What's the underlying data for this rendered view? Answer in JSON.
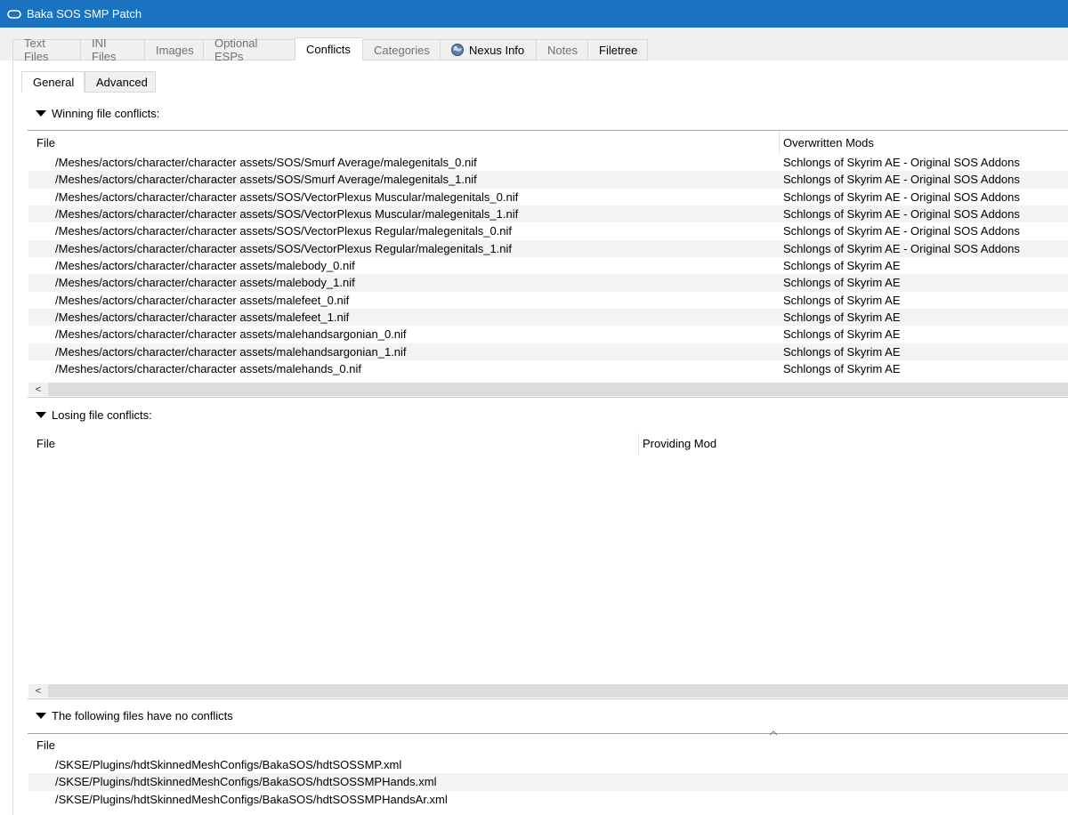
{
  "window": {
    "title": "Baka SOS SMP Patch"
  },
  "tabs": [
    {
      "label": "Text Files"
    },
    {
      "label": "INI Files"
    },
    {
      "label": "Images"
    },
    {
      "label": "Optional ESPs"
    },
    {
      "label": "Conflicts"
    },
    {
      "label": "Categories"
    },
    {
      "label": "Nexus Info"
    },
    {
      "label": "Notes"
    },
    {
      "label": "Filetree"
    }
  ],
  "subtabs": [
    {
      "label": "General"
    },
    {
      "label": "Advanced"
    }
  ],
  "winning": {
    "header": "Winning file conflicts:",
    "col_file": "File",
    "col_mods": "Overwritten Mods",
    "rows": [
      {
        "file": "/Meshes/actors/character/character assets/SOS/Smurf Average/malegenitals_0.nif",
        "mod": "Schlongs of Skyrim AE - Original SOS Addons"
      },
      {
        "file": "/Meshes/actors/character/character assets/SOS/Smurf Average/malegenitals_1.nif",
        "mod": "Schlongs of Skyrim AE - Original SOS Addons"
      },
      {
        "file": "/Meshes/actors/character/character assets/SOS/VectorPlexus Muscular/malegenitals_0.nif",
        "mod": "Schlongs of Skyrim AE - Original SOS Addons"
      },
      {
        "file": "/Meshes/actors/character/character assets/SOS/VectorPlexus Muscular/malegenitals_1.nif",
        "mod": "Schlongs of Skyrim AE - Original SOS Addons"
      },
      {
        "file": "/Meshes/actors/character/character assets/SOS/VectorPlexus Regular/malegenitals_0.nif",
        "mod": "Schlongs of Skyrim AE - Original SOS Addons"
      },
      {
        "file": "/Meshes/actors/character/character assets/SOS/VectorPlexus Regular/malegenitals_1.nif",
        "mod": "Schlongs of Skyrim AE - Original SOS Addons"
      },
      {
        "file": "/Meshes/actors/character/character assets/malebody_0.nif",
        "mod": "Schlongs of Skyrim AE"
      },
      {
        "file": "/Meshes/actors/character/character assets/malebody_1.nif",
        "mod": "Schlongs of Skyrim AE"
      },
      {
        "file": "/Meshes/actors/character/character assets/malefeet_0.nif",
        "mod": "Schlongs of Skyrim AE"
      },
      {
        "file": "/Meshes/actors/character/character assets/malefeet_1.nif",
        "mod": "Schlongs of Skyrim AE"
      },
      {
        "file": "/Meshes/actors/character/character assets/malehandsargonian_0.nif",
        "mod": "Schlongs of Skyrim AE"
      },
      {
        "file": "/Meshes/actors/character/character assets/malehandsargonian_1.nif",
        "mod": "Schlongs of Skyrim AE"
      },
      {
        "file": "/Meshes/actors/character/character assets/malehands_0.nif",
        "mod": "Schlongs of Skyrim AE"
      }
    ]
  },
  "losing": {
    "header": "Losing file conflicts:",
    "col_file": "File",
    "col_mod": "Providing Mod"
  },
  "noconflict": {
    "header": "The following files have no conflicts",
    "col_file": "File",
    "rows": [
      {
        "file": "/SKSE/Plugins/hdtSkinnedMeshConfigs/BakaSOS/hdtSOSSMP.xml"
      },
      {
        "file": "/SKSE/Plugins/hdtSkinnedMeshConfigs/BakaSOS/hdtSOSSMPHands.xml"
      },
      {
        "file": "/SKSE/Plugins/hdtSkinnedMeshConfigs/BakaSOS/hdtSOSSMPHandsAr.xml"
      }
    ]
  },
  "scroll_left_glyph": "<",
  "colors": {
    "titlebar": "#1a73c0"
  }
}
